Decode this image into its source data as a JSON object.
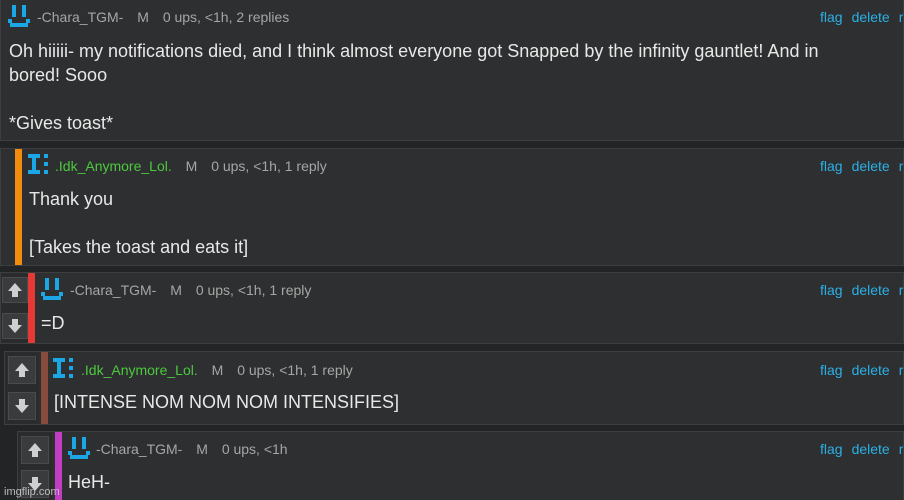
{
  "colors": {
    "link": "#2bb0e6",
    "username_green": "#4cc93e",
    "stripe_orange": "#f28c0f",
    "stripe_red": "#e53935",
    "stripe_brown": "#8a4b3f",
    "stripe_purple": "#c23cc4"
  },
  "actions": {
    "flag": "flag",
    "delete": "delete",
    "more": "r"
  },
  "comments": [
    {
      "username": "-Chara_TGM-",
      "mod": "M",
      "meta": "0 ups, <1h, 2 replies",
      "text": "Oh hiiiii- my notifications died, and I think almost everyone got Snapped by the infinity gauntlet! And in\nbored! Sooo\n\n*Gives toast*"
    },
    {
      "username": ".Idk_Anymore_Lol.",
      "mod": "M",
      "meta": "0 ups, <1h, 1 reply",
      "text": "Thank you\n\n[Takes the toast and eats it]"
    },
    {
      "username": "-Chara_TGM-",
      "mod": "M",
      "meta": "0 ups, <1h, 1 reply",
      "text": "=D"
    },
    {
      "username": ".Idk_Anymore_Lol.",
      "mod": "M",
      "meta": "0 ups, <1h, 1 reply",
      "text": "[INTENSE NOM NOM NOM INTENSIFIES]"
    },
    {
      "username": "-Chara_TGM-",
      "mod": "M",
      "meta": "0 ups, <1h",
      "text": "HeH-"
    }
  ],
  "watermark": "imgflip.com"
}
